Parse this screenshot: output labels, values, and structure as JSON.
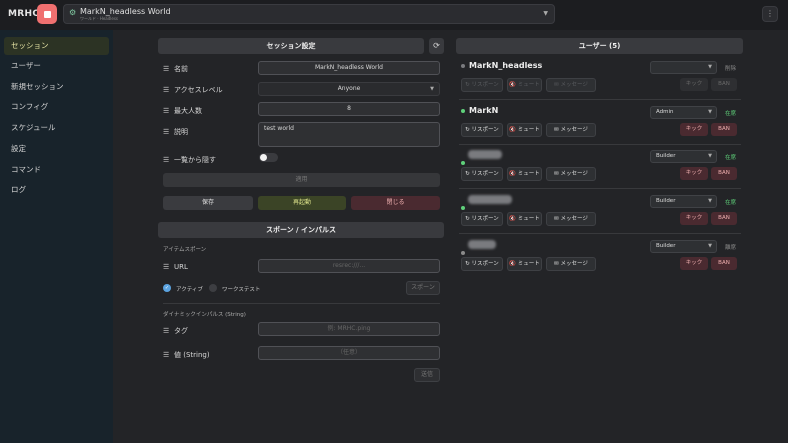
{
  "app": {
    "title": "MRHC",
    "world_name": "MarkN_headless World",
    "world_sub": "ワールド · Headless",
    "menu_label": "⋮"
  },
  "sidebar": {
    "items": [
      {
        "label": "セッション",
        "active": true
      },
      {
        "label": "ユーザー"
      },
      {
        "label": "新規セッション"
      },
      {
        "label": "コンフィグ"
      },
      {
        "label": "スケジュール"
      },
      {
        "label": "設定"
      },
      {
        "label": "コマンド"
      },
      {
        "label": "ログ"
      }
    ]
  },
  "session": {
    "header": "セッション設定",
    "name_label": "名前",
    "name_value": "MarkN_headless World",
    "access_label": "アクセスレベル",
    "access_value": "Anyone",
    "max_label": "最大人数",
    "max_value": "8",
    "desc_label": "説明",
    "desc_value": "test world",
    "hide_label": "一覧から隠す",
    "apply_label": "適用",
    "save_label": "保存",
    "restart_label": "再起動",
    "close_label": "閉じる"
  },
  "spawn": {
    "header": "スポーン / インパルス",
    "item_section": "アイテムスポーン",
    "url_label": "URL",
    "url_placeholder": "resrec:///...",
    "active_label": "アクティブ",
    "worldtest_label": "ワークステスト",
    "spawn_btn": "スポーン",
    "impulse_section": "ダイナミックインパルス (String)",
    "tag_label": "タグ",
    "tag_placeholder": "例: MRHC.ping",
    "value_label": "値 (String)",
    "value_placeholder": "（任意）",
    "send_btn": "送信"
  },
  "users": {
    "header": "ユーザー (5)",
    "list": [
      {
        "name": "MarkN_headless",
        "role": "",
        "status": "削除",
        "status_color": "#8a8a8a",
        "host": true,
        "dot_color": "#7a7b7f"
      },
      {
        "name": "MarkN",
        "role": "Admin",
        "status": "在席",
        "status_color": "#5fd07a",
        "host": false,
        "dot_color": "#5fd07a"
      },
      {
        "name": "",
        "role": "Builder",
        "status": "在席",
        "status_color": "#5fd07a",
        "host": false,
        "dot_color": "#5fd07a"
      },
      {
        "name": "",
        "role": "Builder",
        "status": "在席",
        "status_color": "#5fd07a",
        "host": false,
        "dot_color": "#5fd07a"
      },
      {
        "name": "",
        "role": "Builder",
        "status": "離席",
        "status_color": "#8a8a8a",
        "host": false,
        "dot_color": "#8a8a8a"
      }
    ],
    "respawn_label": "↻ リスポーン",
    "mute_label": "🔇 ミュート",
    "message_label": "✉ メッセージ",
    "kick_label": "キック",
    "ban_label": "BAN"
  }
}
